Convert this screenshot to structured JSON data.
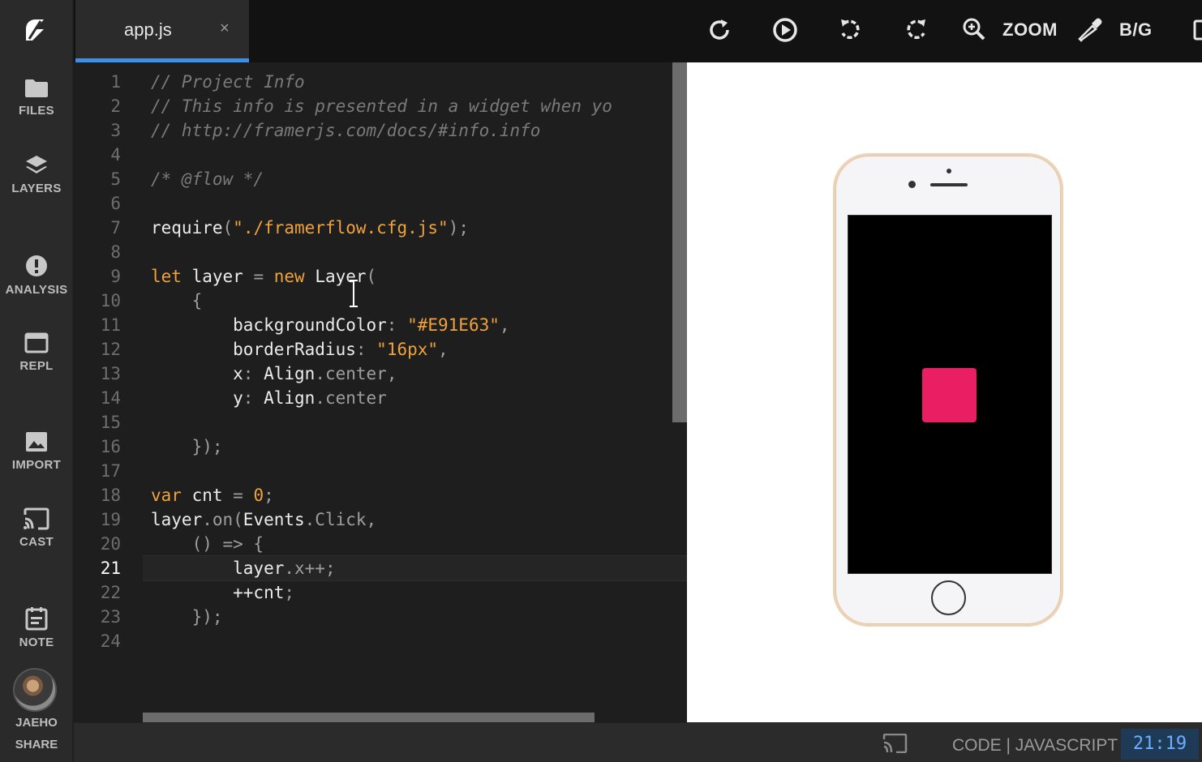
{
  "sidebar": {
    "logo_icon": "framer-logo-icon",
    "items": [
      {
        "label": "FILES",
        "icon": "folder-icon"
      },
      {
        "label": "LAYERS",
        "icon": "layers-icon"
      },
      {
        "label": "ANALYSIS",
        "icon": "alert-circle-icon"
      },
      {
        "label": "REPL",
        "icon": "window-icon"
      },
      {
        "label": "IMPORT",
        "icon": "image-icon"
      },
      {
        "label": "CAST",
        "icon": "cast-icon"
      },
      {
        "label": "NOTE",
        "icon": "note-icon"
      }
    ],
    "user_name": "JAEHO",
    "share_label": "SHARE"
  },
  "editor": {
    "tab_title": "app.js",
    "tab_close": "×",
    "line_numbers": [
      "1",
      "2",
      "3",
      "4",
      "5",
      "6",
      "7",
      "8",
      "9",
      "10",
      "11",
      "12",
      "13",
      "14",
      "15",
      "16",
      "17",
      "18",
      "19",
      "20",
      "21",
      "22",
      "23",
      "24"
    ],
    "active_line": "21",
    "code": {
      "l1": "// Project Info",
      "l2": "// This info is presented in a widget when yo",
      "l3": "// http://framerjs.com/docs/#info.info",
      "l5": "/* @flow */",
      "l7_a": "require",
      "l7_b": "(",
      "l7_c": "\"./framerflow.cfg.js\"",
      "l7_d": ");",
      "l9_a": "let",
      "l9_b": " layer ",
      "l9_c": "=",
      "l9_d": " new",
      "l9_e": " Layer",
      "l9_f": "(",
      "l10": "    {",
      "l11_a": "        backgroundColor",
      "l11_b": ": ",
      "l11_c": "\"#E91E63\"",
      "l11_d": ",",
      "l12_a": "        borderRadius",
      "l12_b": ": ",
      "l12_c": "\"16px\"",
      "l12_d": ",",
      "l13_a": "        x",
      "l13_b": ": ",
      "l13_c": "Align",
      "l13_d": ".center,",
      "l14_a": "        y",
      "l14_b": ": ",
      "l14_c": "Align",
      "l14_d": ".center",
      "l16": "    });",
      "l18_a": "var",
      "l18_b": " cnt ",
      "l18_c": "=",
      "l18_d": " 0",
      "l18_e": ";",
      "l19_a": "layer",
      "l19_b": ".on(",
      "l19_c": "Events",
      "l19_d": ".Click,",
      "l20": "    () => {",
      "l21_a": "        layer",
      "l21_b": ".x++;",
      "l22_a": "        ++cnt",
      "l22_b": ";",
      "l23": "    });"
    }
  },
  "preview_toolbar": {
    "buttons": [
      {
        "icon": "refresh-icon"
      },
      {
        "icon": "play-circle-icon"
      },
      {
        "icon": "rotate-left-icon"
      },
      {
        "icon": "rotate-right-icon"
      },
      {
        "icon": "zoom-in-icon",
        "label": "ZOOM"
      },
      {
        "icon": "eyedropper-icon",
        "label": "B/G"
      }
    ]
  },
  "preview": {
    "device": "iphone",
    "layer_color": "#E91E63"
  },
  "statusbar": {
    "cast_icon": "cast-icon",
    "mode": "CODE | JAVASCRIPT",
    "cursor_position": "21:19"
  }
}
